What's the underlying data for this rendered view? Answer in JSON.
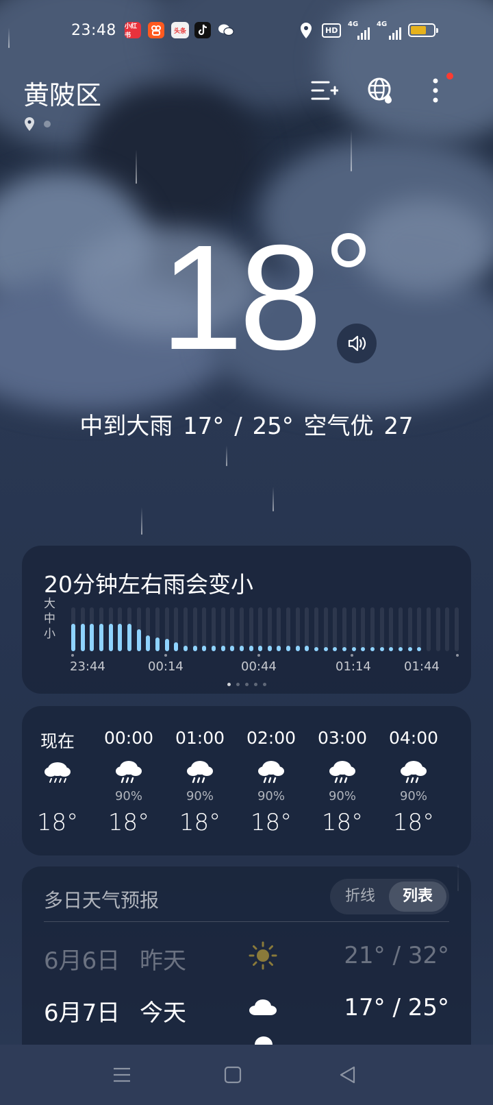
{
  "status_bar": {
    "time": "23:48",
    "apps": [
      {
        "name": "xiaohongshu",
        "label": "小红书",
        "color": "#e8323c"
      },
      {
        "name": "kuaishou",
        "label": "快",
        "color": "#ff5a1f"
      },
      {
        "name": "toutiao",
        "label": "头条",
        "color": "#e83a3a"
      },
      {
        "name": "douyin",
        "label": "抖",
        "color": "#111111"
      },
      {
        "name": "wechat",
        "label": "微",
        "color": "#ffffff"
      }
    ],
    "hd_label": "HD",
    "net1": "4G",
    "net2": "4G",
    "battery_level": 0.6,
    "battery_color": "#e6b21c"
  },
  "header": {
    "location": "黄陂区"
  },
  "current": {
    "temp": "18",
    "summary": "中到大雨  17° / 25°  空气优 27"
  },
  "rain_card": {
    "title": "20分钟左右雨会变小",
    "levels": [
      "大",
      "中",
      "小"
    ],
    "times": [
      "23:44",
      "00:14",
      "00:44",
      "01:14",
      "01:44"
    ],
    "intensity": [
      0.62,
      0.62,
      0.62,
      0.62,
      0.62,
      0.62,
      0.62,
      0.5,
      0.36,
      0.32,
      0.28,
      0.2,
      0.12,
      0.12,
      0.12,
      0.12,
      0.12,
      0.12,
      0.12,
      0.12,
      0.12,
      0.12,
      0.12,
      0.12,
      0.12,
      0.12,
      0.06,
      0.06,
      0.06,
      0.06,
      0.06,
      0.06,
      0.06,
      0.06,
      0.06,
      0.06,
      0.06,
      0.06,
      0,
      0,
      0,
      0
    ],
    "bar_color": "#8fd3ff",
    "pages": 5,
    "active_page": 0
  },
  "hourly": [
    {
      "time": "现在",
      "icon": "rain-cloud-icon",
      "prob": "",
      "temp": "18°"
    },
    {
      "time": "00:00",
      "icon": "rain-cloud-icon",
      "prob": "90%",
      "temp": "18°"
    },
    {
      "time": "01:00",
      "icon": "rain-cloud-icon",
      "prob": "90%",
      "temp": "18°"
    },
    {
      "time": "02:00",
      "icon": "rain-cloud-icon",
      "prob": "90%",
      "temp": "18°"
    },
    {
      "time": "03:00",
      "icon": "rain-cloud-icon",
      "prob": "90%",
      "temp": "18°"
    },
    {
      "time": "04:00",
      "icon": "rain-cloud-icon",
      "prob": "90%",
      "temp": "18°"
    }
  ],
  "daily": {
    "title": "多日天气预报",
    "toggle": {
      "line": "折线",
      "list": "列表",
      "selected": "列表"
    },
    "rows": [
      {
        "date": "6月6日",
        "label": "昨天",
        "icon": "sun-icon",
        "temps": "21° / 32°",
        "past": true
      },
      {
        "date": "6月7日",
        "label": "今天",
        "icon": "cloud-icon",
        "temps": "17° / 25°",
        "past": false
      }
    ]
  }
}
